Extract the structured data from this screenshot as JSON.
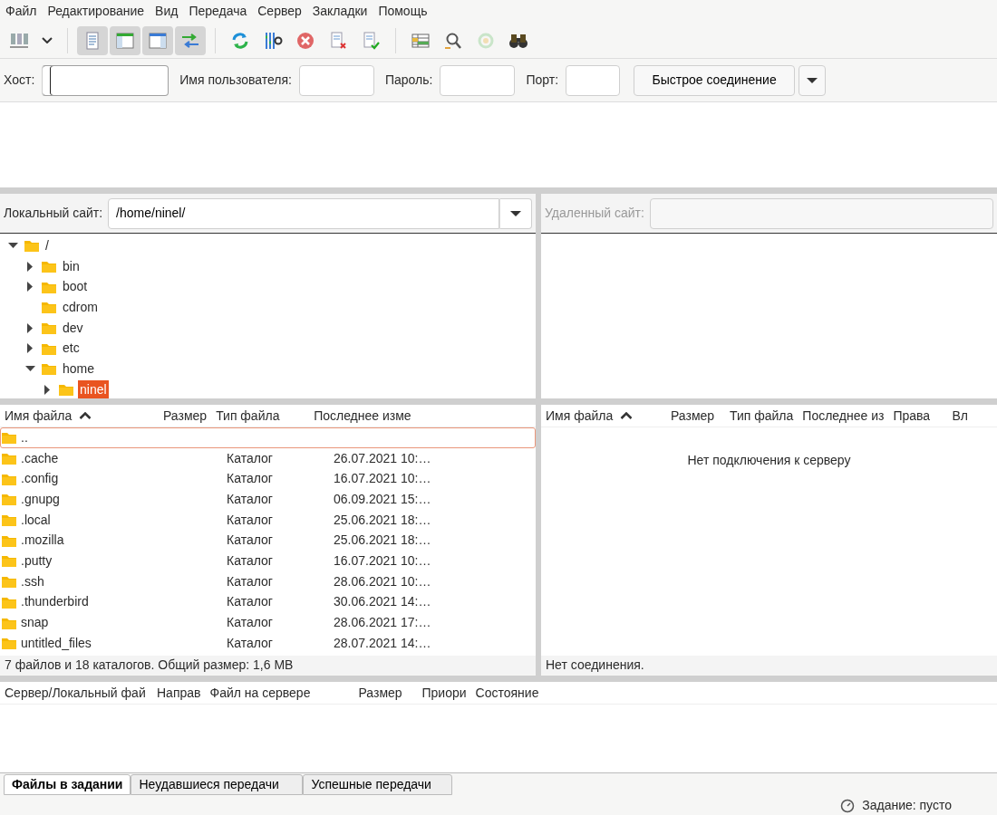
{
  "menu": [
    {
      "label": "Файл"
    },
    {
      "label": "Редактирование"
    },
    {
      "label": "Вид"
    },
    {
      "label": "Передача"
    },
    {
      "label": "Сервер"
    },
    {
      "label": "Закладки"
    },
    {
      "label": "Помощь"
    }
  ],
  "toolbar": [
    {
      "kind": "button",
      "disabled": false
    },
    {
      "kind": "dropdown",
      "disabled": false
    },
    {
      "kind": "toggle",
      "on": true,
      "disabled": false
    },
    {
      "kind": "toggle",
      "on": true,
      "disabled": false
    },
    {
      "kind": "toggle",
      "on": true,
      "disabled": false
    },
    {
      "kind": "toggle",
      "on": true,
      "disabled": false
    },
    {
      "kind": "button",
      "disabled": false
    },
    {
      "kind": "button",
      "disabled": false
    },
    {
      "kind": "button",
      "disabled": false
    },
    {
      "kind": "button",
      "disabled": false
    },
    {
      "kind": "button",
      "disabled": false
    },
    {
      "kind": "button",
      "disabled": false
    },
    {
      "kind": "button",
      "disabled": false
    },
    {
      "kind": "button",
      "disabled": true
    },
    {
      "kind": "button",
      "disabled": false
    }
  ],
  "quickconnect": {
    "fields": [
      {
        "label": "Хост:",
        "focused": true
      },
      {
        "label": "Имя пользователя:",
        "focused": false
      },
      {
        "label": "Пароль:",
        "focused": false
      },
      {
        "label": "Порт:",
        "focused": false
      }
    ],
    "button": "Быстрое соединение"
  },
  "local": {
    "site_label": "Локальный сайт:",
    "path": "/home/ninel/",
    "tree": [
      {
        "name": "/",
        "expanded": true,
        "has_children": true,
        "selected": false,
        "children": [
          {
            "name": "bin",
            "expanded": false,
            "has_children": true,
            "selected": false
          },
          {
            "name": "boot",
            "expanded": false,
            "has_children": true,
            "selected": false
          },
          {
            "name": "cdrom",
            "expanded": false,
            "has_children": false,
            "selected": false
          },
          {
            "name": "dev",
            "expanded": false,
            "has_children": true,
            "selected": false
          },
          {
            "name": "etc",
            "expanded": false,
            "has_children": true,
            "selected": false
          },
          {
            "name": "home",
            "expanded": true,
            "has_children": true,
            "selected": false,
            "children": [
              {
                "name": "ninel",
                "expanded": false,
                "has_children": true,
                "selected": true
              }
            ]
          }
        ]
      }
    ],
    "columns": [
      {
        "label": "Имя файла",
        "sorted": true
      },
      {
        "label": "Размер",
        "sorted": false
      },
      {
        "label": "Тип файла",
        "sorted": false
      },
      {
        "label": "Последнее изме",
        "sorted": false
      }
    ],
    "rows": [
      {
        "name": "..",
        "focused": true
      },
      {
        "name": ".cache",
        "type": "Каталог",
        "modified": "26.07.2021 10:…",
        "focused": false
      },
      {
        "name": ".config",
        "type": "Каталог",
        "modified": "16.07.2021 10:…",
        "focused": false
      },
      {
        "name": ".gnupg",
        "type": "Каталог",
        "modified": "06.09.2021 15:…",
        "focused": false
      },
      {
        "name": ".local",
        "type": "Каталог",
        "modified": "25.06.2021 18:…",
        "focused": false
      },
      {
        "name": ".mozilla",
        "type": "Каталог",
        "modified": "25.06.2021 18:…",
        "focused": false
      },
      {
        "name": ".putty",
        "type": "Каталог",
        "modified": "16.07.2021 10:…",
        "focused": false
      },
      {
        "name": ".ssh",
        "type": "Каталог",
        "modified": "28.06.2021 10:…",
        "focused": false
      },
      {
        "name": ".thunderbird",
        "type": "Каталог",
        "modified": "30.06.2021 14:…",
        "focused": false
      },
      {
        "name": "snap",
        "type": "Каталог",
        "modified": "28.06.2021 17:…",
        "focused": false
      },
      {
        "name": "untitled_files",
        "type": "Каталог",
        "modified": "28.07.2021 14:…",
        "focused": false
      }
    ],
    "status": "7 файлов и 18 каталогов. Общий размер: 1,6 MB"
  },
  "remote": {
    "site_label": "Удаленный сайт:",
    "disabled": true,
    "columns": [
      {
        "label": "Имя файла",
        "sorted": true
      },
      {
        "label": "Размер",
        "sorted": false
      },
      {
        "label": "Тип файла",
        "sorted": false
      },
      {
        "label": "Последнее из",
        "sorted": false
      },
      {
        "label": "Права",
        "sorted": false
      },
      {
        "label": "Вл",
        "sorted": false
      }
    ],
    "empty_message": "Нет подключения к серверу",
    "status": "Нет соединения."
  },
  "queue": {
    "columns": [
      {
        "label": "Сервер/Локальный фай"
      },
      {
        "label": "Направ"
      },
      {
        "label": "Файл на сервере"
      },
      {
        "label": "Размер"
      },
      {
        "label": "Приори"
      },
      {
        "label": "Состояние"
      }
    ]
  },
  "tabs": [
    {
      "label": "Файлы в задании",
      "selected": true
    },
    {
      "label": "Неудавшиеся передачи",
      "selected": false
    },
    {
      "label": "Успешные передачи",
      "selected": false
    }
  ],
  "status_bar": {
    "text": "Задание: пусто"
  }
}
